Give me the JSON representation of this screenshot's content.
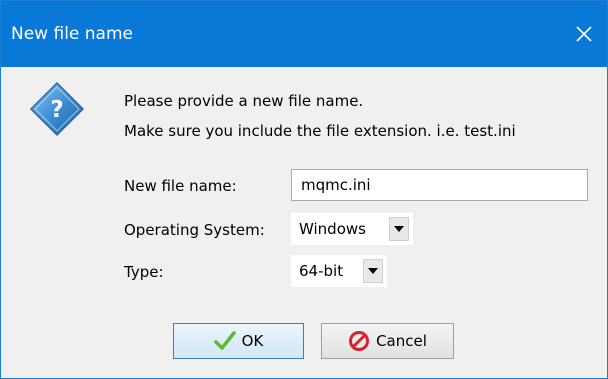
{
  "window": {
    "title": "New file name"
  },
  "message": {
    "line1": "Please provide a new file name.",
    "line2": "Make sure you include the file extension. i.e. test.ini"
  },
  "form": {
    "file_name_label": "New file name:",
    "file_name_value": "mqmc.ini",
    "os_label": "Operating System:",
    "os_value": "Windows",
    "type_label": "Type:",
    "type_value": "64-bit"
  },
  "buttons": {
    "ok_label": "OK",
    "cancel_label": "Cancel"
  },
  "icons": {
    "dialog": "question-icon",
    "close": "close-icon",
    "ok": "checkmark-icon",
    "cancel": "prohibit-icon",
    "dropdown": "triangle-down-icon"
  },
  "colors": {
    "titlebar": "#0a78d7",
    "background": "#f0f0f0",
    "ok_check": "#5fb832",
    "cancel_icon": "#d6232c",
    "question_diamond": "#3d8fd6"
  }
}
